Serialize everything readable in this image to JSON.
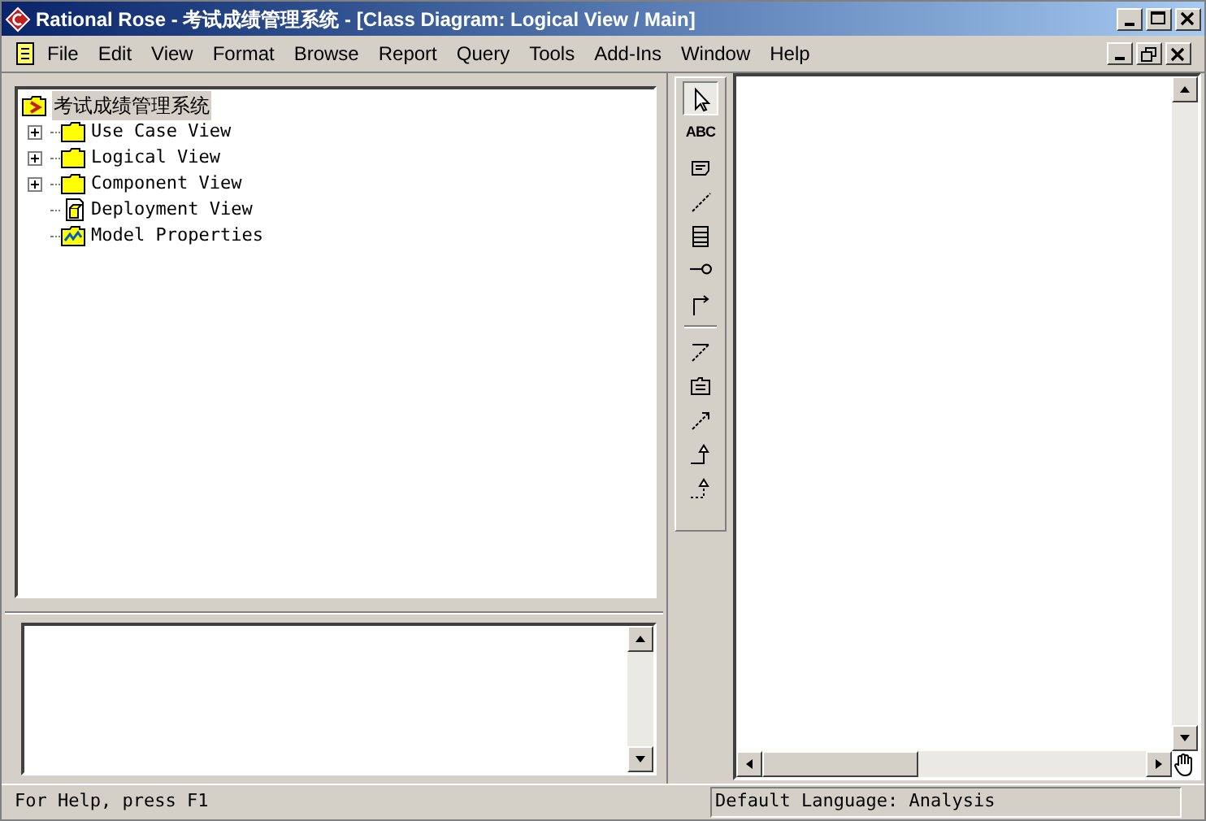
{
  "window": {
    "title": "Rational Rose - 考试成绩管理系统 - [Class Diagram: Logical View / Main]"
  },
  "menu": [
    "File",
    "Edit",
    "View",
    "Format",
    "Browse",
    "Report",
    "Query",
    "Tools",
    "Add-Ins",
    "Window",
    "Help"
  ],
  "tree": {
    "root": {
      "label": "考试成绩管理系统",
      "selected": true
    },
    "children": [
      {
        "label": "Use Case View",
        "kind": "folder",
        "expandable": true
      },
      {
        "label": "Logical View",
        "kind": "folder",
        "expandable": true
      },
      {
        "label": "Component View",
        "kind": "folder",
        "expandable": true
      },
      {
        "label": "Deployment View",
        "kind": "deployment",
        "expandable": false
      },
      {
        "label": "Model Properties",
        "kind": "properties",
        "expandable": false
      }
    ]
  },
  "toolbox": [
    {
      "kind": "pointer",
      "selected": true
    },
    {
      "kind": "text",
      "label": "ABC",
      "selected": false
    },
    {
      "kind": "note",
      "selected": false
    },
    {
      "kind": "anchor",
      "selected": false
    },
    {
      "kind": "class",
      "selected": false
    },
    {
      "kind": "interface",
      "selected": false
    },
    {
      "kind": "association",
      "selected": false
    },
    {
      "kind": "separator"
    },
    {
      "kind": "aggregation",
      "selected": false
    },
    {
      "kind": "package",
      "selected": false
    },
    {
      "kind": "dependency",
      "selected": false
    },
    {
      "kind": "generalization",
      "selected": false
    },
    {
      "kind": "realization",
      "selected": false
    }
  ],
  "status_bar": {
    "help": "For Help, press F1",
    "language": "Default Language: Analysis"
  }
}
